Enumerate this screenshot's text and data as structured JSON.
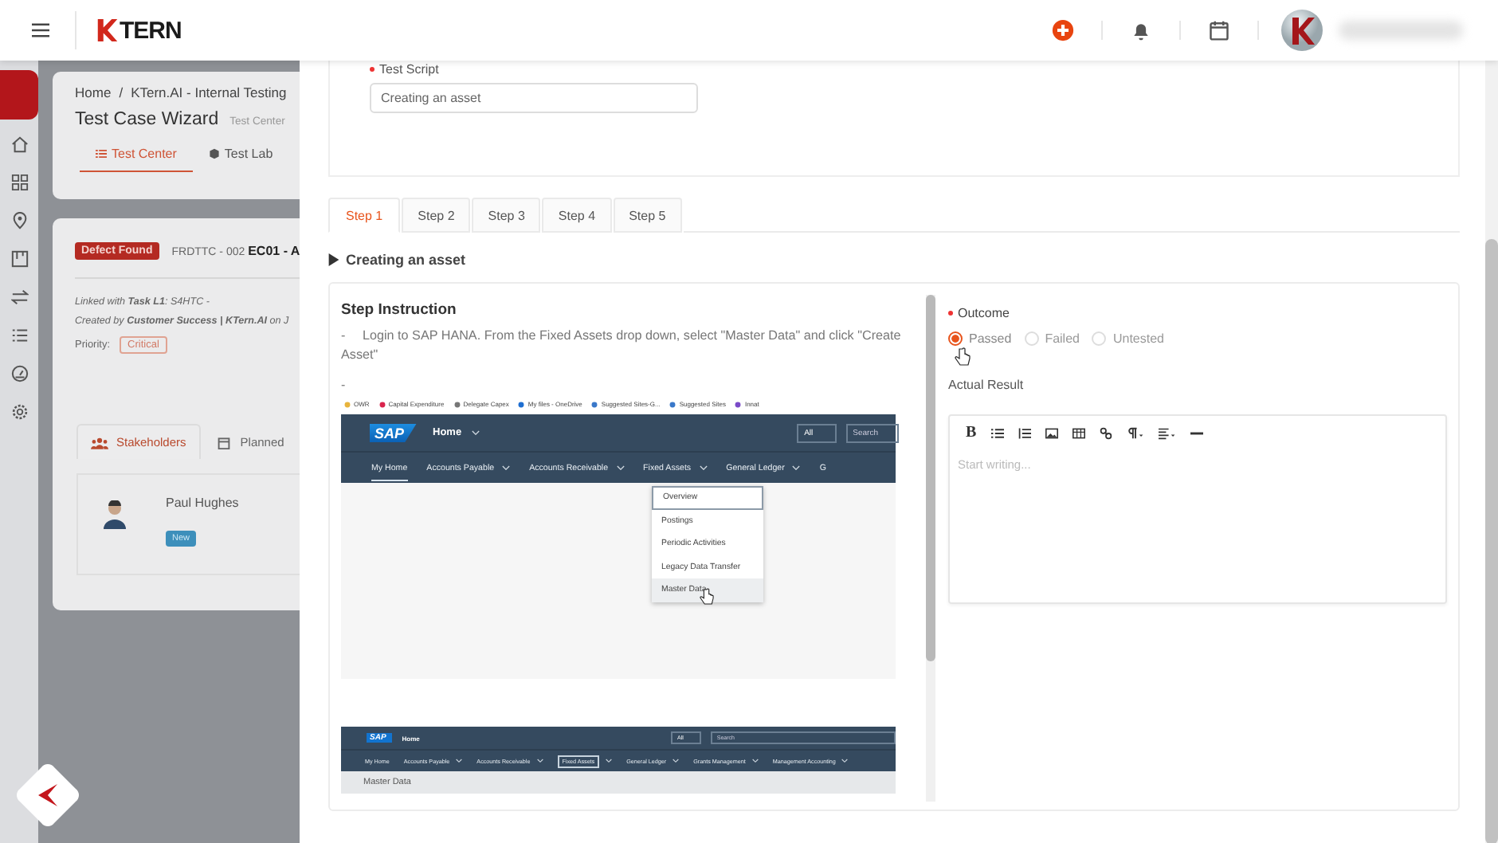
{
  "header": {
    "logo": "TERN"
  },
  "breadcrumb": {
    "items": [
      "Home",
      "KTern.AI - Internal Testing"
    ],
    "separator": "/"
  },
  "page": {
    "title": "Test Case Wizard",
    "subtitle": "Test Center"
  },
  "page_tabs": [
    {
      "label": "Test Center",
      "selected": true
    },
    {
      "label": "Test Lab",
      "selected": false
    }
  ],
  "test_case": {
    "status": "Defect Found",
    "code": "FRDTTC - 002 **EC01 - A**",
    "linked": "Linked with **Task L1**: S4HTC -",
    "created": "Created by **Customer Success | KTern.AI** on J",
    "priority_label": "Priority:",
    "priority": "Critical"
  },
  "detail_tabs": [
    {
      "label": "Stakeholders",
      "selected": true
    },
    {
      "label": "Planned",
      "selected": false
    }
  ],
  "stakeholder": {
    "name": "Paul Hughes",
    "status": "New"
  },
  "test_script": {
    "label": "Test Script",
    "required": true,
    "value": "Creating an asset"
  },
  "steps": [
    {
      "label": "Step 1",
      "selected": true
    },
    {
      "label": "Step 2",
      "selected": false
    },
    {
      "label": "Step 3",
      "selected": false
    },
    {
      "label": "Step 4",
      "selected": false
    },
    {
      "label": "Step 5",
      "selected": false
    }
  ],
  "section": {
    "title": "Creating an asset"
  },
  "instruction": {
    "title": "Step Instruction",
    "text": "-\tLogin to SAP HANA. From the Fixed Assets drop down, select \"Master Data\" and click \"Create Asset\"",
    "after": "-"
  },
  "screens": [
    {
      "bookmarks": [
        "OWR",
        "Capital Expenditure",
        "Delegate Capex",
        "My files - OneDrive",
        "Suggested Sites-G...",
        "Suggested Sites",
        "Innat"
      ],
      "logo": "SAP",
      "home": "Home",
      "scope": "All",
      "search": "Search",
      "nav": [
        {
          "label": "My Home",
          "selected": true,
          "has_menu": false
        },
        {
          "label": "Accounts Payable",
          "selected": false,
          "has_menu": true
        },
        {
          "label": "Accounts Receivable",
          "selected": false,
          "has_menu": true
        },
        {
          "label": "Fixed Assets",
          "selected": false,
          "has_menu": true
        },
        {
          "label": "General Ledger",
          "selected": false,
          "has_menu": true
        },
        {
          "label": "G",
          "selected": false,
          "has_menu": false
        }
      ],
      "menu": [
        {
          "label": "Overview",
          "selected": false
        },
        {
          "label": "Postings",
          "selected": false
        },
        {
          "label": "Periodic Activities",
          "selected": false
        },
        {
          "label": "Legacy Data Transfer",
          "selected": false
        },
        {
          "label": "Master Data",
          "selected": true
        }
      ]
    },
    {
      "logo": "SAP",
      "home": "Home",
      "scope": "All",
      "search": "Search",
      "nav": [
        {
          "label": "My Home",
          "selected": false,
          "has_menu": false
        },
        {
          "label": "Accounts Payable",
          "selected": false,
          "has_menu": true
        },
        {
          "label": "Accounts Receivable",
          "selected": false,
          "has_menu": true
        },
        {
          "label": "Fixed Assets",
          "selected": true,
          "has_menu": true
        },
        {
          "label": "General Ledger",
          "selected": false,
          "has_menu": true
        },
        {
          "label": "Grants Management",
          "selected": false,
          "has_menu": true
        },
        {
          "label": "Management Accounting",
          "selected": false,
          "has_menu": true
        }
      ],
      "page_title": "Master Data"
    }
  ],
  "outcome": {
    "label": "Outcome",
    "required": true,
    "options": [
      {
        "label": "Passed",
        "selected": true
      },
      {
        "label": "Failed",
        "selected": false
      },
      {
        "label": "Untested",
        "selected": false
      }
    ]
  },
  "actual_result": {
    "label": "Actual Result",
    "bold_label": "B",
    "placeholder": "Start writing..."
  }
}
